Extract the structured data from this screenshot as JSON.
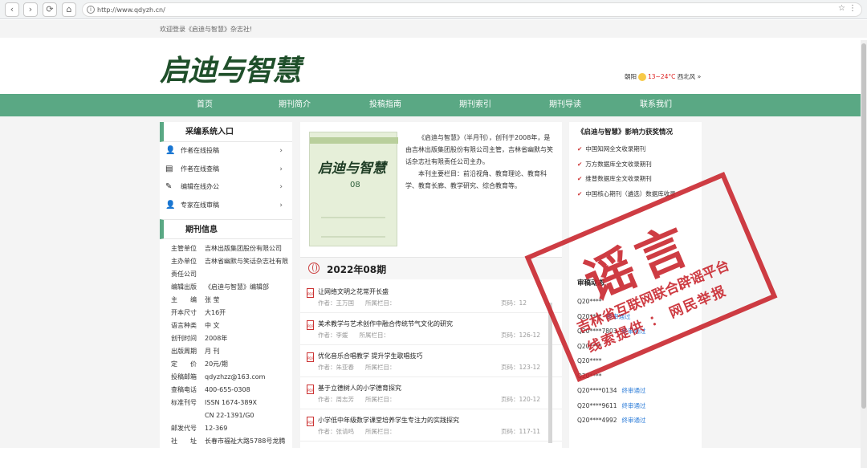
{
  "browser": {
    "url": "http://www.qdyzh.cn/",
    "back_glyph": "‹",
    "forward_glyph": "›",
    "reload_glyph": "⟳",
    "home_glyph": "⌂",
    "info_glyph": "i",
    "star_glyph": "☆",
    "more_glyph": "⋮"
  },
  "topbar": {
    "welcome": "欢迎登录《启迪与智慧》杂志社!"
  },
  "header": {
    "logo": "启迪与智慧",
    "weather": {
      "city": "朝阳",
      "temp": "13~24°C",
      "wind": "西北风 »"
    }
  },
  "nav": [
    "首页",
    "期刊简介",
    "投稿指南",
    "期刊索引",
    "期刊导读",
    "联系我们"
  ],
  "left": {
    "system_title": "采编系统入口",
    "system_items": [
      {
        "icon": "author-icon",
        "glyph": "👤",
        "label": "作者在线投稿"
      },
      {
        "icon": "document-icon",
        "glyph": "▤",
        "label": "作者在线查稿"
      },
      {
        "icon": "pen-icon",
        "glyph": "✎",
        "label": "编辑在线办公"
      },
      {
        "icon": "expert-icon",
        "glyph": "👤",
        "label": "专家在线审稿"
      }
    ],
    "arrow_glyph": "›",
    "info_title": "期刊信息",
    "info": [
      {
        "k": "主管单位",
        "v": "吉林出版集团股份有限公司"
      },
      {
        "k": "主办单位",
        "v": "吉林省幽默与笑话杂志社有限责任公司"
      },
      {
        "k": "编辑出版",
        "v": "《启迪与智慧》编辑部"
      },
      {
        "k": "主　　编",
        "v": "张 莹"
      },
      {
        "k": "开本尺寸",
        "v": "大16开"
      },
      {
        "k": "语言种类",
        "v": "中 文"
      },
      {
        "k": "创刊时间",
        "v": "2008年"
      },
      {
        "k": "出版周期",
        "v": "月 刊"
      },
      {
        "k": "定　　价",
        "v": "20元/期"
      },
      {
        "k": "投稿邮箱",
        "v": "qdyzhzz@163.com"
      },
      {
        "k": "查稿电话",
        "v": "400-655-0308"
      },
      {
        "k": "标准刊号",
        "v": "ISSN 1674-389X"
      },
      {
        "k": "",
        "v": "CN 22-1391/G0"
      },
      {
        "k": "邮发代号",
        "v": "12-369"
      },
      {
        "k": "社　　址",
        "v": "长春市福祉大路5788号龙腾"
      }
    ]
  },
  "middle": {
    "cover": {
      "title": "启迪与智慧",
      "issue_no": "08"
    },
    "intro_p1": "《启迪与智慧》（半月刊），创刊于2008年，是由吉林出版集团股份有限公司主管，吉林省幽默与笑话杂志社有限责任公司主办。",
    "intro_p2": "本刊主要栏目：前沿视角、教育理论、教育科学、教育长廊、教学研究、综合教育等。",
    "issue_title": "2022年08期",
    "pdf_label": "PDF",
    "articles": [
      {
        "title": "让网络文明之花常开长盛",
        "author": "作者：王万国",
        "column": "所属栏目：",
        "page": "页码：12"
      },
      {
        "title": "美术教学与艺术创作中融合传统节气文化的研究",
        "author": "作者：李媛",
        "column": "所属栏目：",
        "page": "页码：126-12"
      },
      {
        "title": "优化音乐合唱教学 提升学生歌唱技巧",
        "author": "作者：朱亚春",
        "column": "所属栏目：",
        "page": "页码：123-12"
      },
      {
        "title": "基于立德树人的小学德育探究",
        "author": "作者：周志芳",
        "column": "所属栏目：",
        "page": "页码：120-12"
      },
      {
        "title": "小学低中年级数学课堂培养学生专注力的实践探究",
        "author": "作者：张请鸣",
        "column": "所属栏目：",
        "page": "页码：117-11"
      }
    ]
  },
  "right": {
    "title": "《启迪与智慧》影响力获奖情况",
    "check_glyph": "✔",
    "awards": [
      "中国知网全文收录期刊",
      "万方数据库全文收录期刊",
      "维普数据库全文收录期刊",
      "中国核心期刊（遴选）数据库收录"
    ],
    "review_title": "审稿动态",
    "reviews": [
      {
        "id": "Q20****",
        "status": ""
      },
      {
        "id": "Q20****",
        "status": "终审通过"
      },
      {
        "id": "Q20****7803",
        "status": "终审通过"
      },
      {
        "id": "Q20****",
        "status": ""
      },
      {
        "id": "Q20****",
        "status": ""
      },
      {
        "id": "Q20****",
        "status": ""
      },
      {
        "id": "Q20****0134",
        "status": "终审通过"
      },
      {
        "id": "Q20****9611",
        "status": "终审通过"
      },
      {
        "id": "Q20****4992",
        "status": "终审通过"
      }
    ]
  },
  "stamp": {
    "big": "谣言",
    "line1": "吉林省互联网联合辟谣平台",
    "line2": "线索提供 ： 网民举报"
  },
  "colors": {
    "nav_green": "#5aa884",
    "stamp_red": "#c8222a",
    "logo_green": "#1f4f2a"
  }
}
